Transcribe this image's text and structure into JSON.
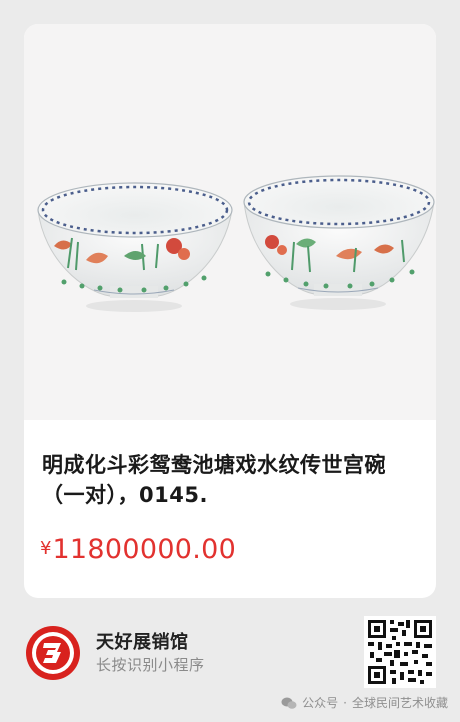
{
  "product": {
    "image_alt": "明成化斗彩鸳鸯池塘戏水纹传世宫碗（一对）",
    "title": "明成化斗彩鸳鸯池塘戏水纹传世宫碗（一对），0145.",
    "price_currency": "¥",
    "price_value": "11800000.00"
  },
  "shop": {
    "name": "天好展销馆",
    "hint": "长按识别小程序",
    "logo_icon": "shop-logo-icon",
    "qr_icon": "qr-code-icon"
  },
  "watermark": {
    "platform": "公众号",
    "separator": "·",
    "account": "全球民间艺术收藏"
  },
  "colors": {
    "price": "#e2322f",
    "logo_red": "#d8221e",
    "card_bg": "#ffffff",
    "page_bg": "#ebebeb"
  }
}
